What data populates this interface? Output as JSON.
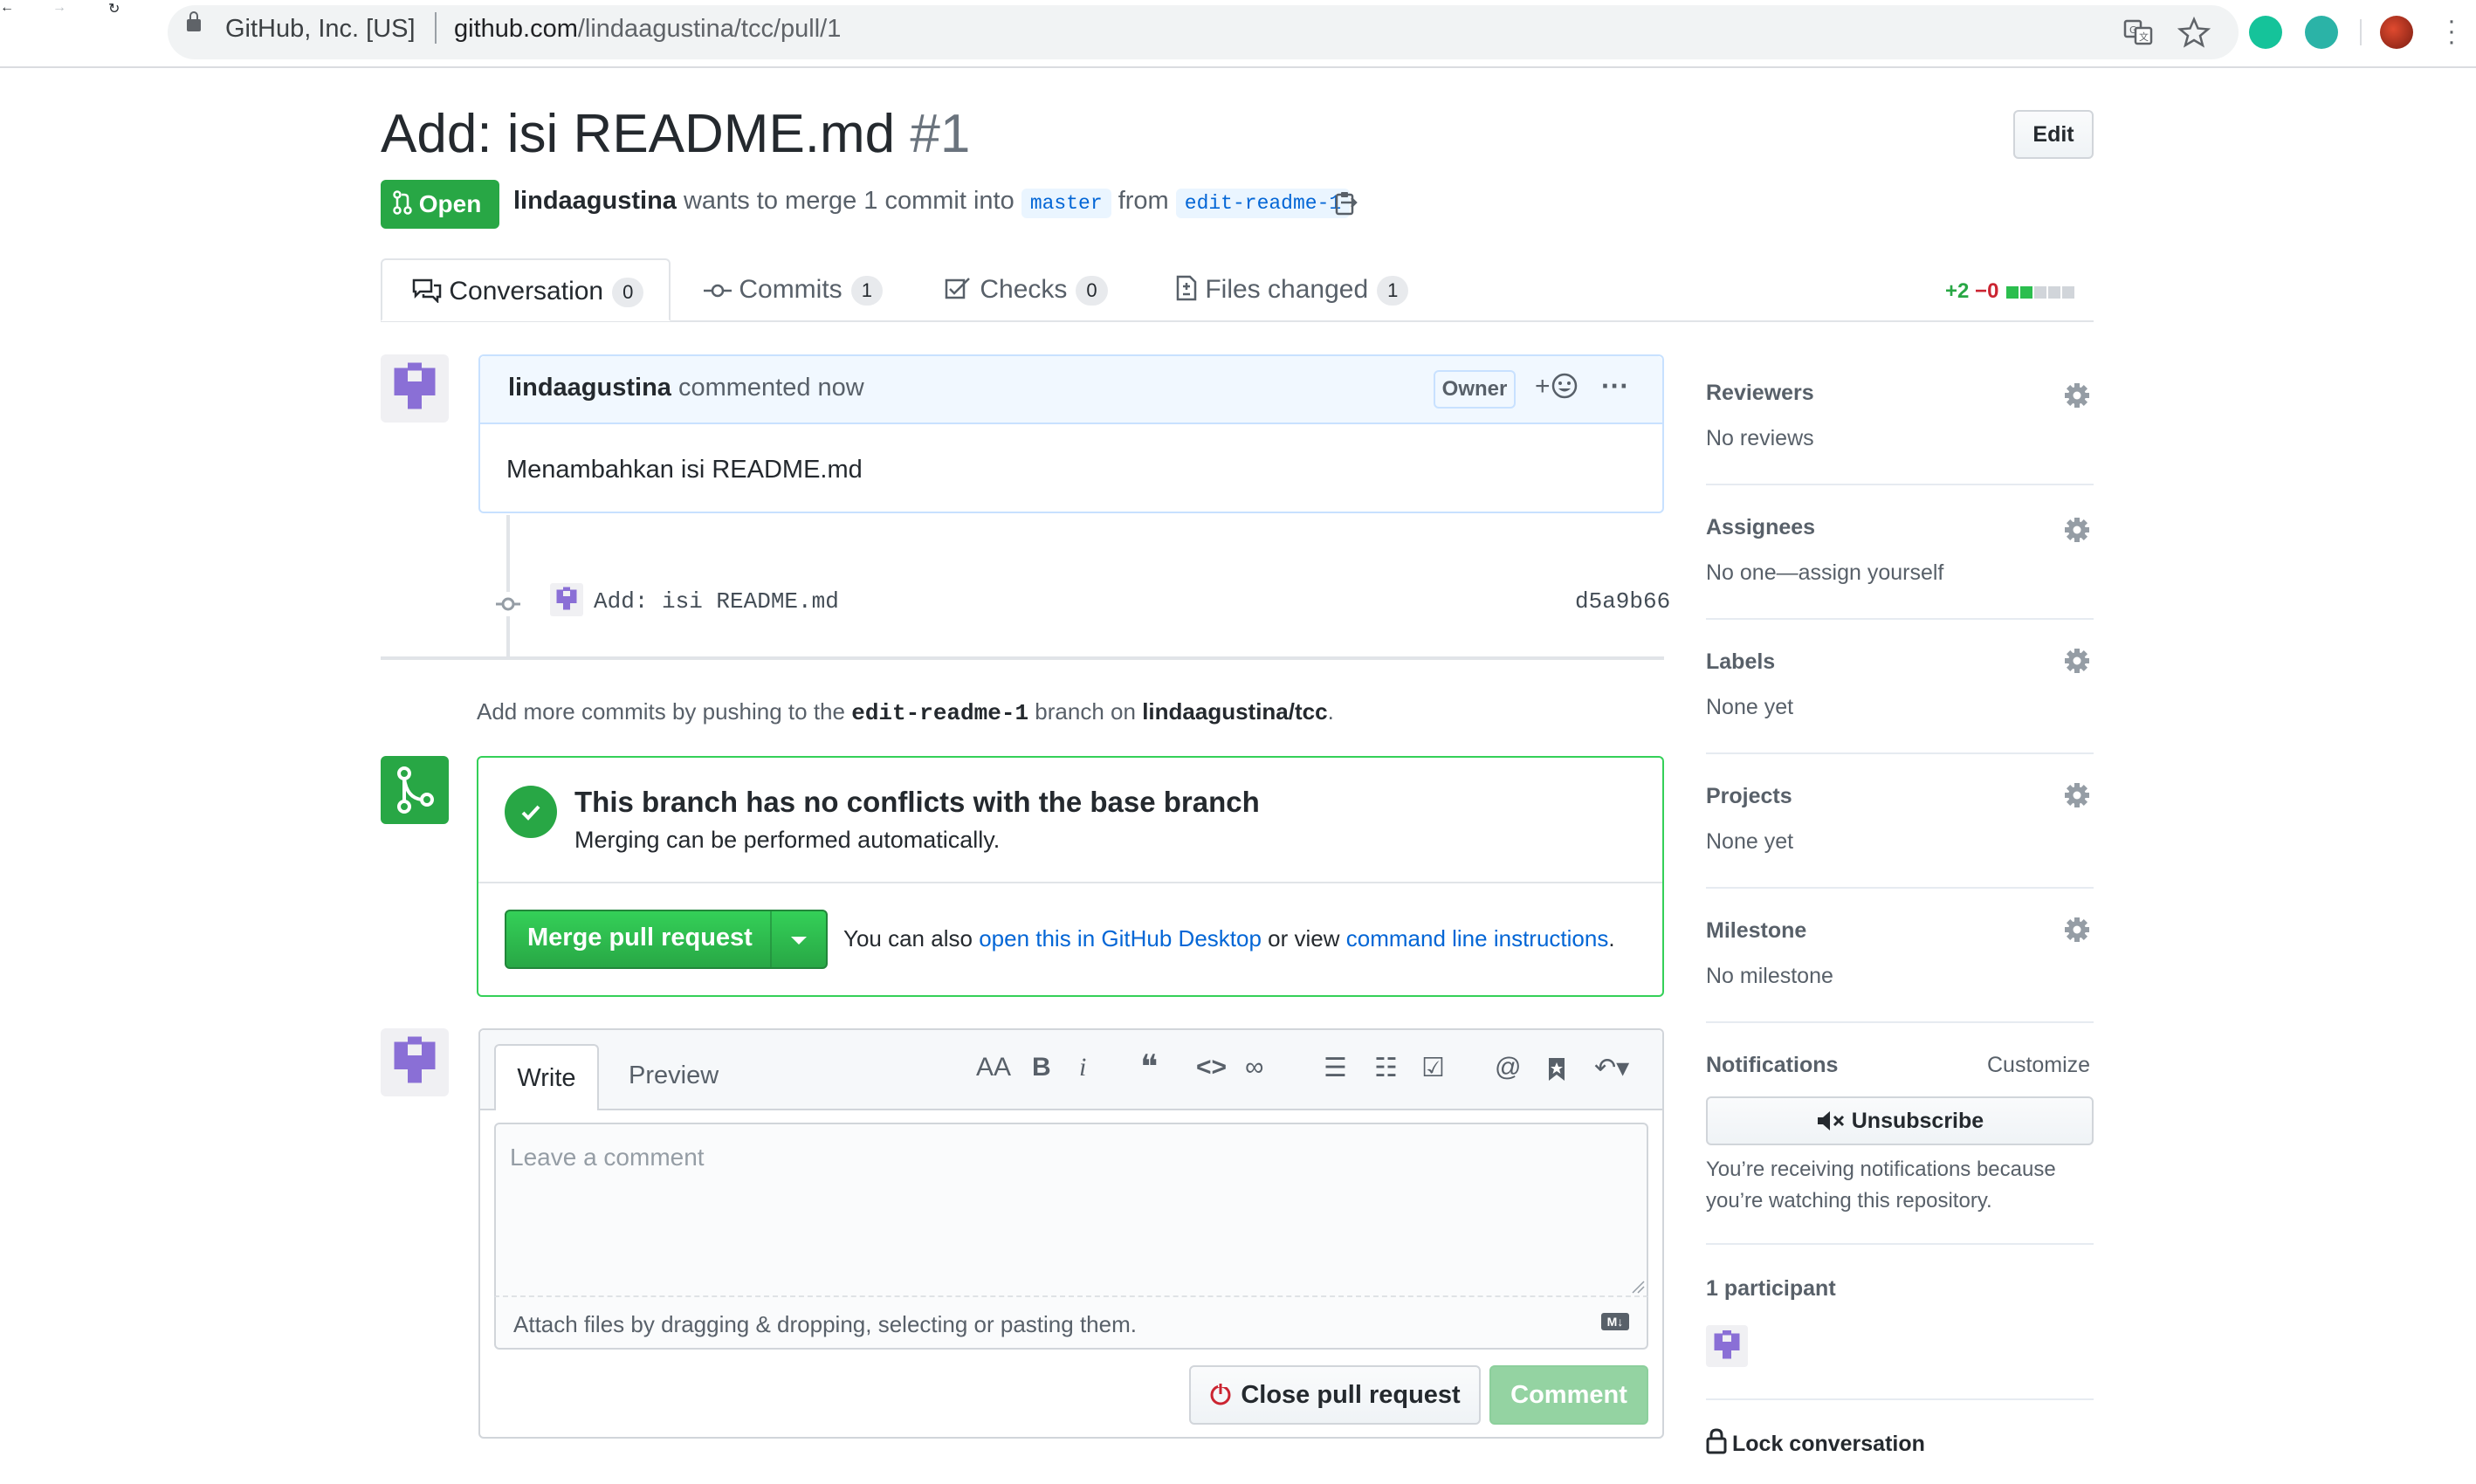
{
  "browser": {
    "back_icon": "←",
    "forward_icon": "→",
    "reload_icon": "↻",
    "site_identity": "GitHub, Inc. [US]",
    "url_host": "github.com",
    "url_path": "/lindaagustina/tcc/pull/1"
  },
  "pr": {
    "title": "Add: isi README.md",
    "number": "#1",
    "edit_label": "Edit",
    "state": "Open",
    "author": "lindaagustina",
    "meta_text_1": "wants to merge 1 commit into",
    "base_branch": "master",
    "meta_from": "from",
    "head_branch": "edit-readme-1"
  },
  "tabs": [
    {
      "label": "Conversation",
      "count": "0"
    },
    {
      "label": "Commits",
      "count": "1"
    },
    {
      "label": "Checks",
      "count": "0"
    },
    {
      "label": "Files changed",
      "count": "1"
    }
  ],
  "diffstat": {
    "additions": "+2",
    "deletions": "−0"
  },
  "comment": {
    "author": "lindaagustina",
    "action": "commented now",
    "badge": "Owner",
    "reaction_label": "+",
    "more_label": "···",
    "body": "Menambahkan isi README.md"
  },
  "commit": {
    "message": "Add: isi README.md",
    "sha": "d5a9b66"
  },
  "push_note": {
    "before": "Add more commits by pushing to the",
    "branch": "edit-readme-1",
    "middle": "branch on",
    "repo": "lindaagustina/tcc",
    "after": "."
  },
  "merge": {
    "title": "This branch has no conflicts with the base branch",
    "subtitle": "Merging can be performed automatically.",
    "button_label": "Merge pull request",
    "hint_before": "You can also",
    "hint_link1": "open this in GitHub Desktop",
    "hint_middle": "or view",
    "hint_link2": "command line instructions",
    "hint_after": "."
  },
  "form": {
    "write_tab": "Write",
    "preview_tab": "Preview",
    "placeholder": "Leave a comment",
    "attach_text": "Attach files by dragging & dropping, selecting or pasting them.",
    "md_badge": "M↓",
    "close_label": "Close pull request",
    "comment_label": "Comment",
    "toolbar": {
      "heading": "AA",
      "bold": "B",
      "italic": "i",
      "quote": "❝",
      "code": "<>",
      "link": "∞",
      "ul": "☰",
      "ol": "☷",
      "tasks": "☑",
      "mention": "@",
      "saved": "🔖",
      "reply": "↶▾"
    }
  },
  "sidebar": {
    "reviewers": {
      "title": "Reviewers",
      "value": "No reviews"
    },
    "assignees": {
      "title": "Assignees",
      "value": "No one—assign yourself"
    },
    "labels": {
      "title": "Labels",
      "value": "None yet"
    },
    "projects": {
      "title": "Projects",
      "value": "None yet"
    },
    "milestone": {
      "title": "Milestone",
      "value": "No milestone"
    },
    "notifications": {
      "title": "Notifications",
      "customize": "Customize",
      "unsubscribe": "Unsubscribe",
      "text": "You’re receiving notifications because you’re watching this repository."
    },
    "participants": {
      "title": "1 participant"
    },
    "lock": {
      "label": "Lock conversation"
    }
  },
  "colors": {
    "green": "#28a745",
    "link": "#0366d6",
    "avatar": "#8a6fd6"
  }
}
